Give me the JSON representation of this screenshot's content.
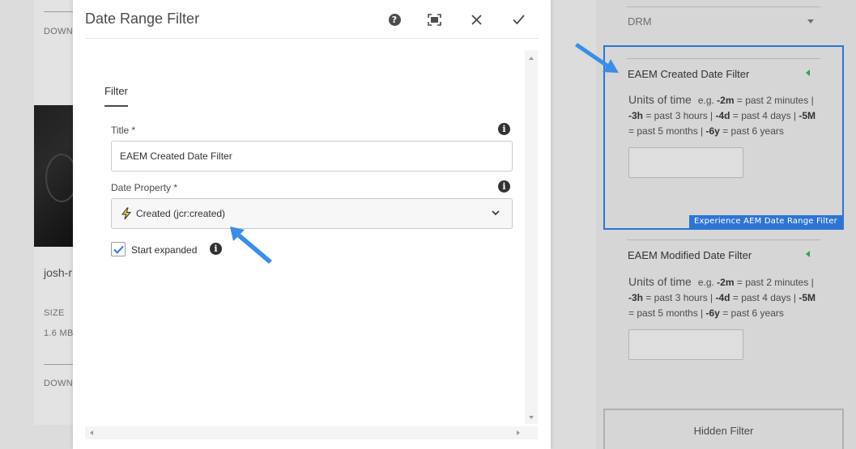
{
  "background": {
    "left_download_top": "DOWN",
    "left_name": "josh-r",
    "left_size_label": "SIZE",
    "left_size_value": "1.6 MB",
    "left_download_bottom": "DOWN",
    "drm_label": "DRM",
    "filters": [
      {
        "title": "EAEM Created Date Filter",
        "units_label": "Units of time",
        "help_eg": "e.g.",
        "help_parts": [
          "-2m",
          " = past 2 minutes | ",
          "-3h",
          " = past 3 hours | ",
          "-4d",
          " = past 4 days | ",
          "-5M",
          " = past 5 months | ",
          "-6y",
          " = past 6 years"
        ],
        "badge": "Experience AEM Date Range Filter"
      },
      {
        "title": "EAEM Modified Date Filter",
        "units_label": "Units of time",
        "help_eg": "e.g.",
        "help_parts": [
          "-2m",
          " = past 2 minutes | ",
          "-3h",
          " = past 3 hours | ",
          "-4d",
          " = past 4 days | ",
          "-5M",
          " = past 5 months | ",
          "-6y",
          " = past 6 years"
        ]
      }
    ],
    "hidden_filter_label": "Hidden Filter"
  },
  "dialog": {
    "title": "Date Range Filter",
    "help_icon": "help-icon",
    "fullscreen_icon": "fullscreen-icon",
    "close_icon": "close-icon",
    "done_icon": "checkmark-icon",
    "tab_label": "Filter",
    "title_field": {
      "label": "Title *",
      "value": "EAEM Created Date Filter"
    },
    "date_property": {
      "label": "Date Property *",
      "selected": "Created (jcr:created)",
      "icon": "lightning-bolt-icon"
    },
    "start_expanded": {
      "label": "Start expanded",
      "checked": true
    }
  },
  "colors": {
    "accent": "#2d75d2",
    "arrow": "#3a8ee6"
  }
}
